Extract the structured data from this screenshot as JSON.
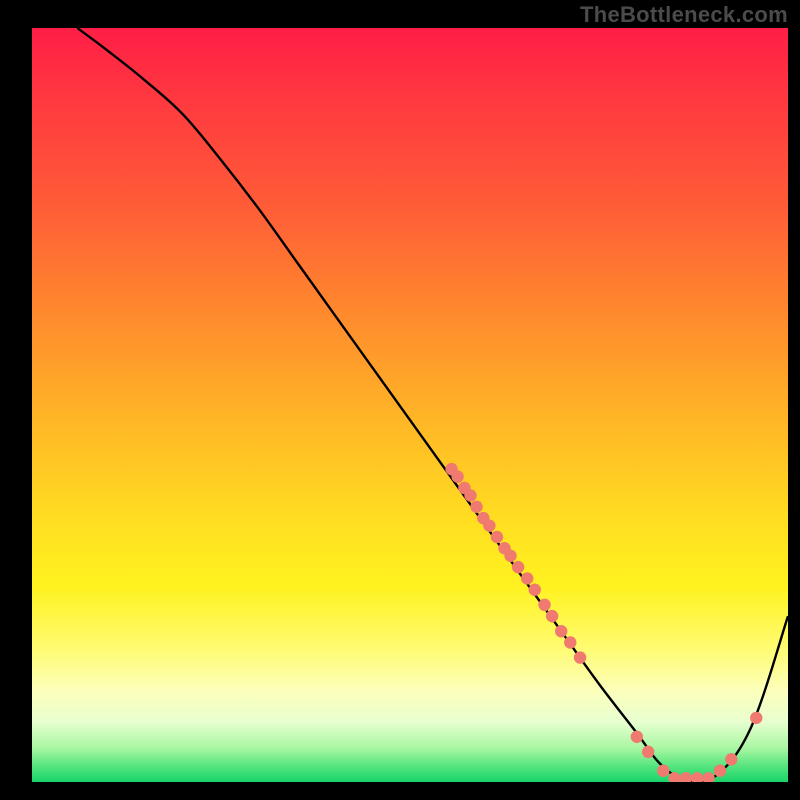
{
  "watermark": "TheBottleneck.com",
  "chart_data": {
    "type": "line",
    "title": "",
    "xlabel": "",
    "ylabel": "",
    "xlim": [
      0,
      100
    ],
    "ylim": [
      0,
      100
    ],
    "curve": {
      "x": [
        6,
        10,
        15,
        20,
        25,
        30,
        35,
        40,
        45,
        50,
        55,
        60,
        65,
        70,
        75,
        80,
        83,
        86,
        90,
        95,
        100
      ],
      "y": [
        100,
        97,
        93,
        88.5,
        82.5,
        76,
        69,
        62,
        55,
        48,
        41,
        34,
        27,
        20,
        13,
        6.5,
        2.5,
        0.5,
        0.5,
        7,
        22
      ]
    },
    "markers": [
      {
        "x": 55.5,
        "y": 41.5
      },
      {
        "x": 56.3,
        "y": 40.5
      },
      {
        "x": 57.2,
        "y": 39.0
      },
      {
        "x": 58.0,
        "y": 38.0
      },
      {
        "x": 58.8,
        "y": 36.5
      },
      {
        "x": 59.7,
        "y": 35.0
      },
      {
        "x": 60.5,
        "y": 34.0
      },
      {
        "x": 61.5,
        "y": 32.5
      },
      {
        "x": 62.5,
        "y": 31.0
      },
      {
        "x": 63.3,
        "y": 30.0
      },
      {
        "x": 64.3,
        "y": 28.5
      },
      {
        "x": 65.5,
        "y": 27.0
      },
      {
        "x": 66.5,
        "y": 25.5
      },
      {
        "x": 67.8,
        "y": 23.5
      },
      {
        "x": 68.8,
        "y": 22.0
      },
      {
        "x": 70.0,
        "y": 20.0
      },
      {
        "x": 71.2,
        "y": 18.5
      },
      {
        "x": 72.5,
        "y": 16.5
      },
      {
        "x": 80.0,
        "y": 6.0
      },
      {
        "x": 81.5,
        "y": 4.0
      },
      {
        "x": 83.5,
        "y": 1.5
      },
      {
        "x": 85.0,
        "y": 0.5
      },
      {
        "x": 86.5,
        "y": 0.5
      },
      {
        "x": 88.0,
        "y": 0.5
      },
      {
        "x": 89.5,
        "y": 0.5
      },
      {
        "x": 91.0,
        "y": 1.5
      },
      {
        "x": 92.5,
        "y": 3.0
      },
      {
        "x": 95.8,
        "y": 8.5
      }
    ],
    "marker_color": "#f07a6f",
    "line_color": "#000000",
    "line_width": 2.4
  }
}
